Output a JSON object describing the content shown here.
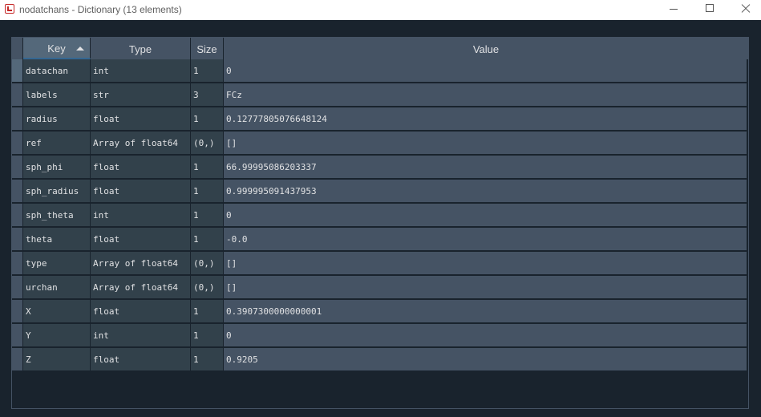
{
  "window": {
    "title": "nodatchans - Dictionary (13 elements)"
  },
  "table": {
    "columns": [
      "Key",
      "Type",
      "Size",
      "Value"
    ],
    "sort": {
      "column": "Key",
      "direction": "ascending"
    },
    "rows": [
      {
        "key": "datachan",
        "type": "int",
        "size": "1",
        "value": "0"
      },
      {
        "key": "labels",
        "type": "str",
        "size": "3",
        "value": "FCz"
      },
      {
        "key": "radius",
        "type": "float",
        "size": "1",
        "value": "0.12777805076648124"
      },
      {
        "key": "ref",
        "type": "Array of float64",
        "size": "(0,)",
        "value": "[]"
      },
      {
        "key": "sph_phi",
        "type": "float",
        "size": "1",
        "value": "66.99995086203337"
      },
      {
        "key": "sph_radius",
        "type": "float",
        "size": "1",
        "value": "0.999995091437953"
      },
      {
        "key": "sph_theta",
        "type": "int",
        "size": "1",
        "value": "0"
      },
      {
        "key": "theta",
        "type": "float",
        "size": "1",
        "value": "-0.0"
      },
      {
        "key": "type",
        "type": "Array of float64",
        "size": "(0,)",
        "value": "[]"
      },
      {
        "key": "urchan",
        "type": "Array of float64",
        "size": "(0,)",
        "value": "[]"
      },
      {
        "key": "X",
        "type": "float",
        "size": "1",
        "value": "0.3907300000000001"
      },
      {
        "key": "Y",
        "type": "int",
        "size": "1",
        "value": "0"
      },
      {
        "key": "Z",
        "type": "float",
        "size": "1",
        "value": "0.9205"
      }
    ]
  },
  "colors": {
    "background": "#19232d",
    "header": "#455364",
    "cell": "#32414b",
    "value_cell": "#455364",
    "text": "#e0e1e3"
  }
}
